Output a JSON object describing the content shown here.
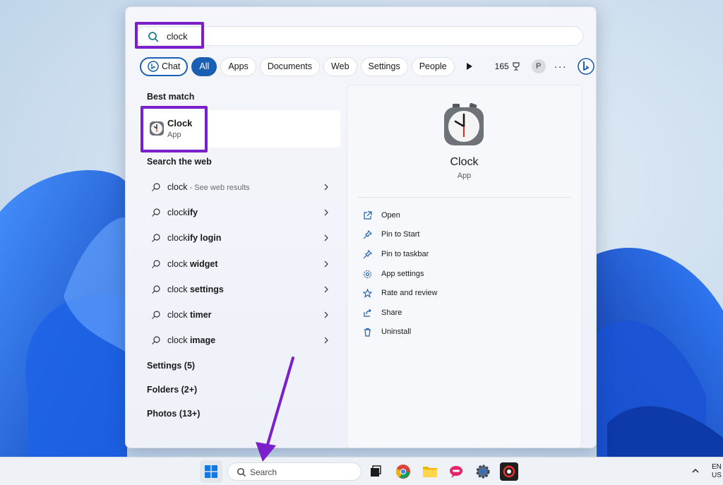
{
  "search": {
    "query": "clock"
  },
  "filters": {
    "chat": "Chat",
    "items": [
      "All",
      "Apps",
      "Documents",
      "Web",
      "Settings",
      "People"
    ],
    "points": "165",
    "profile_initial": "P",
    "more": "···"
  },
  "best_match": {
    "heading": "Best match",
    "name": "Clock",
    "type": "App"
  },
  "web": {
    "heading": "Search the web",
    "rows": [
      {
        "query": "clock",
        "suffix": " - See web results"
      },
      {
        "prefix": "clock",
        "rest": "ify"
      },
      {
        "prefix": "clock",
        "rest": "ify login"
      },
      {
        "prefix": "clock",
        "rest": " widget"
      },
      {
        "prefix": "clock",
        "rest": " settings"
      },
      {
        "prefix": "clock",
        "rest": " timer"
      },
      {
        "prefix": "clock",
        "rest": " image"
      }
    ]
  },
  "groups": [
    "Settings (5)",
    "Folders (2+)",
    "Photos (13+)"
  ],
  "detail": {
    "name": "Clock",
    "type": "App",
    "actions": [
      "Open",
      "Pin to Start",
      "Pin to taskbar",
      "App settings",
      "Rate and review",
      "Share",
      "Uninstall"
    ]
  },
  "taskbar": {
    "search_label": "Search",
    "tray_lang_1": "EN",
    "tray_lang_2": "US"
  },
  "colors": {
    "accent": "#1a5fb4",
    "highlight": "#7a1fc9"
  },
  "icons": [
    "search-icon",
    "chevron-right-icon",
    "open-icon",
    "pin-icon",
    "gear-icon",
    "star-icon",
    "share-icon",
    "trash-icon",
    "windows-logo-icon",
    "clock-app-icon",
    "bing-icon"
  ]
}
